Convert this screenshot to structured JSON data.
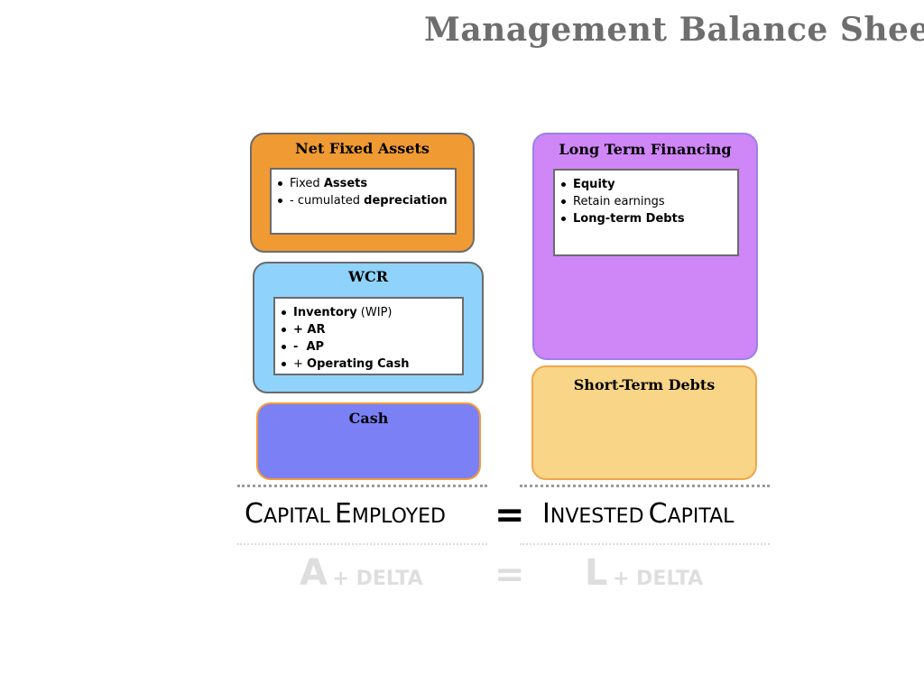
{
  "title": "Management Balance Sheet",
  "boxes": {
    "net_fixed_assets": {
      "title": "Net Fixed Assets",
      "items": [
        {
          "pre": "Fixed ",
          "bold": "Assets"
        },
        {
          "pre": "- cumulated ",
          "bold": "depreciation"
        }
      ]
    },
    "wcr": {
      "title": "WCR",
      "items": [
        {
          "bold": "Inventory",
          "post": " (WIP)"
        },
        {
          "bold": "+ AR"
        },
        {
          "bold": "-  AP"
        },
        {
          "pre": "+ ",
          "bold": "Operating Cash"
        }
      ]
    },
    "cash": {
      "title": "Cash"
    },
    "long_term_financing": {
      "title": "Long Term Financing",
      "items": [
        {
          "bold": "Equity"
        },
        {
          "pre": "Retain earnings"
        },
        {
          "bold": "Long-term Debts"
        }
      ]
    },
    "short_term_debts": {
      "title": "Short-Term Debts"
    }
  },
  "equation": {
    "left": {
      "first": "C",
      "rest": "APITAL",
      "first2": "E",
      "rest2": "MPLOYED"
    },
    "equals": "=",
    "right": {
      "first": "I",
      "rest": "NVESTED",
      "first2": "C",
      "rest2": "APITAL"
    }
  },
  "formula": {
    "left_letter": "A",
    "left_delta": "+ DELTA",
    "equals": "=",
    "right_letter": "L",
    "right_delta": "+ DELTA"
  },
  "colors": {
    "net_fixed_assets": "#f09a33",
    "wcr": "#8fd2fb",
    "cash": "#7b80f5",
    "long_term_financing": "#cf86f7",
    "short_term_debts": "#f8d587"
  }
}
